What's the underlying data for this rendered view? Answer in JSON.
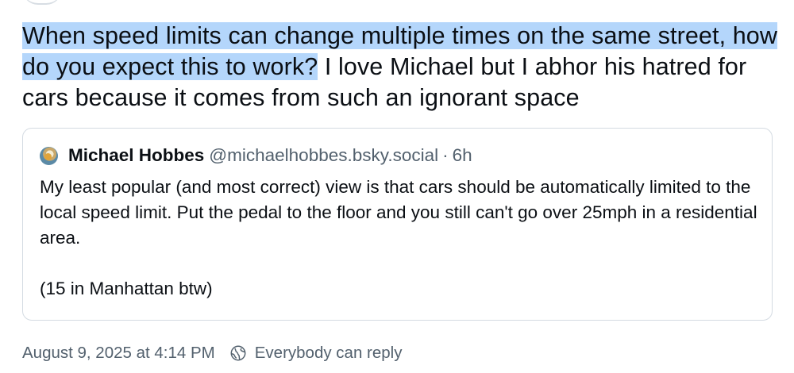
{
  "post": {
    "text_highlighted": "When speed limits can change multiple times on the same street, how do you expect this to work?",
    "text_rest": " I love Michael but I abhor his hatred for cars because it comes from such an ignorant space"
  },
  "quote": {
    "avatar_icon": "avatar-image",
    "author_name": "Michael Hobbes",
    "author_handle": "@michaelhobbes.bsky.social",
    "separator": "·",
    "time": "6h",
    "body": "My least popular (and most correct) view is that cars should be automatically limited to the local speed limit. Put the pedal to the floor and you still can't go over 25mph in a residential area.\n\n(15 in Manhattan btw)"
  },
  "meta": {
    "timestamp": "August 9, 2025 at 4:14 PM",
    "reply_icon": "globe-icon",
    "reply_setting": "Everybody can reply"
  },
  "colors": {
    "highlight": "#b4d6fb",
    "text": "#0b0f14",
    "muted": "#52606d",
    "border": "#d4dbe2"
  }
}
